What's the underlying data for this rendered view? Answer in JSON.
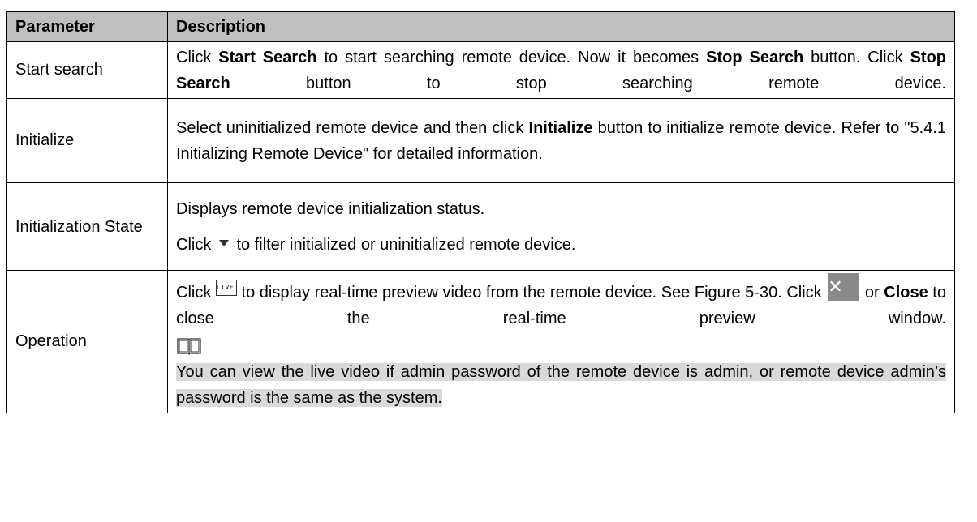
{
  "table": {
    "headers": [
      "Parameter",
      "Description"
    ],
    "rows": [
      {
        "param": "Start search",
        "desc": {
          "t1": "Click ",
          "b1": "Start Search",
          "t2": " to start searching remote device. Now it becomes ",
          "b2": "Stop Search",
          "t3": " button. Click ",
          "b3": "Stop Search",
          "t4": " button to stop searching remote device."
        }
      },
      {
        "param": "Initialize",
        "desc": {
          "t1": "Select uninitialized remote device and then click ",
          "b1": "Initialize",
          "t2": " button to initialize remote device. Refer to \"5.4.1 Initializing Remote Device\" for detailed information."
        }
      },
      {
        "param": "Initialization State",
        "desc": {
          "line1": "Displays remote device initialization status.",
          "t1": "Click ",
          "t2": " to filter initialized or uninitialized remote device."
        }
      },
      {
        "param": "Operation",
        "desc": {
          "t1": "Click ",
          "live_icon": "LIVE",
          "t2": " to display real-time preview video from the remote device. See Figure 5-30. Click ",
          "t3": " or ",
          "b1": "Close",
          "t4": " to close the real-time preview window.",
          "note": "You can view the live video if admin password of the remote device is admin, or remote device admin’s password is the same as the system."
        }
      }
    ]
  },
  "icons": {
    "dropdown": "dropdown-triangle-icon",
    "live": "live-icon",
    "close": "close-icon",
    "note": "note-book-icon"
  }
}
